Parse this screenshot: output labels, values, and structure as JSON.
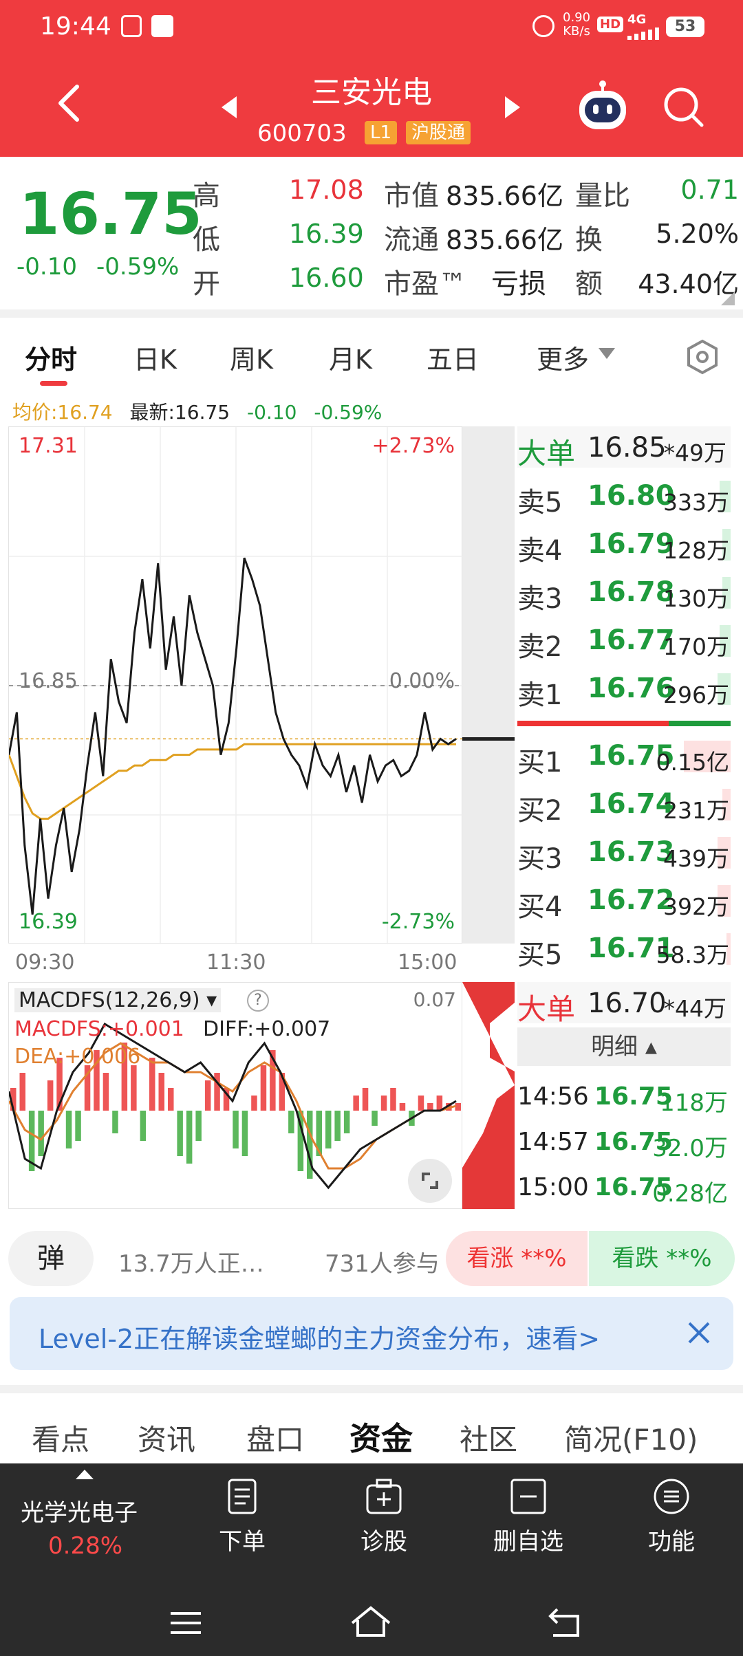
{
  "status": {
    "time": "19:44",
    "speed": "0.90",
    "speed_unit": "KB/s",
    "hd": "HD",
    "net": "4G",
    "battery": "53"
  },
  "header": {
    "title": "三安光电",
    "code": "600703",
    "tag_level": "L1",
    "tag_market": "沪股通"
  },
  "quote": {
    "price": "16.75",
    "change": "-0.10",
    "change_pct": "-0.59%",
    "high_label": "高",
    "high": "17.08",
    "low_label": "低",
    "low": "16.39",
    "open_label": "开",
    "open": "16.60",
    "mcap_label": "市值",
    "mcap": "835.66亿",
    "float_label": "流通",
    "float": "835.66亿",
    "pe_label": "市盈™",
    "pe": "亏损",
    "volratio_label": "量比",
    "volratio": "0.71",
    "turnover_label": "换",
    "turnover": "5.20%",
    "amount_label": "额",
    "amount": "43.40亿"
  },
  "tabs": [
    "分时",
    "日K",
    "周K",
    "月K",
    "五日",
    "更多"
  ],
  "chart_info": {
    "avg": "均价:16.74",
    "latest": "最新:16.75",
    "chg": "-0.10",
    "chg_pct": "-0.59%"
  },
  "chart_data": {
    "type": "line",
    "y_top": "17.31",
    "y_mid": "16.85",
    "y_bottom": "16.39",
    "pct_top": "+2.73%",
    "pct_mid": "0.00%",
    "pct_bottom": "-2.73%",
    "x_ticks": [
      "09:30",
      "11:30",
      "15:00"
    ],
    "ylim": [
      16.39,
      17.31
    ],
    "price": [
      16.72,
      16.8,
      16.55,
      16.42,
      16.6,
      16.45,
      16.55,
      16.62,
      16.5,
      16.58,
      16.7,
      16.8,
      16.68,
      16.9,
      16.82,
      16.78,
      16.95,
      17.05,
      16.92,
      17.08,
      16.88,
      16.98,
      16.85,
      17.02,
      16.95,
      16.9,
      16.85,
      16.72,
      16.78,
      16.92,
      17.09,
      17.05,
      17.0,
      16.9,
      16.8,
      16.75,
      16.72,
      16.7,
      16.66,
      16.74,
      16.7,
      16.68,
      16.72,
      16.65,
      16.7,
      16.63,
      16.72,
      16.67,
      16.7,
      16.71,
      16.68,
      16.69,
      16.72,
      16.8,
      16.73,
      16.75,
      16.74,
      16.75
    ],
    "avg": [
      16.72,
      16.68,
      16.64,
      16.61,
      16.6,
      16.6,
      16.61,
      16.62,
      16.63,
      16.64,
      16.65,
      16.66,
      16.67,
      16.68,
      16.69,
      16.69,
      16.7,
      16.7,
      16.71,
      16.71,
      16.71,
      16.72,
      16.72,
      16.72,
      16.73,
      16.73,
      16.73,
      16.73,
      16.73,
      16.73,
      16.74,
      16.74,
      16.74,
      16.74,
      16.74,
      16.74,
      16.74,
      16.74,
      16.74,
      16.74,
      16.74,
      16.74,
      16.74,
      16.74,
      16.74,
      16.74,
      16.74,
      16.74,
      16.74,
      16.74,
      16.74,
      16.74,
      16.74,
      16.74,
      16.74,
      16.74,
      16.74,
      16.74
    ]
  },
  "macd": {
    "title": "MACDFS(12,26,9)",
    "macdfs": "MACDFS:+0.001",
    "diff": "DIFF:+0.007",
    "dea": "DEA:+0.006",
    "ymax": "0.07",
    "hist": [
      0.3,
      0.5,
      -0.8,
      -0.6,
      0.4,
      0.7,
      -0.5,
      -0.4,
      0.6,
      0.8,
      0.5,
      -0.3,
      0.9,
      0.6,
      -0.4,
      0.7,
      0.5,
      0.3,
      -0.6,
      -0.7,
      -0.4,
      0.4,
      0.5,
      0.3,
      -0.5,
      -0.6,
      0.2,
      0.6,
      0.8,
      0.5,
      -0.3,
      -0.8,
      -0.9,
      -0.6,
      -0.5,
      -0.4,
      -0.3,
      0.2,
      0.3,
      -0.2,
      0.2,
      0.3,
      0.1,
      -0.2,
      0.2,
      0.1,
      0.2,
      0.1,
      0.1
    ],
    "diff_line": [
      0.2,
      -0.5,
      -0.6,
      0.0,
      0.4,
      0.6,
      0.9,
      0.8,
      0.7,
      0.6,
      0.5,
      0.4,
      0.5,
      0.3,
      0.1,
      0.5,
      0.7,
      0.4,
      0.0,
      -0.6,
      -0.8,
      -0.6,
      -0.4,
      -0.3,
      -0.2,
      -0.1,
      0.0,
      0.0,
      0.1
    ],
    "dea_line": [
      0.1,
      -0.2,
      -0.3,
      -0.1,
      0.2,
      0.4,
      0.6,
      0.7,
      0.6,
      0.5,
      0.5,
      0.4,
      0.4,
      0.3,
      0.2,
      0.4,
      0.5,
      0.4,
      0.1,
      -0.3,
      -0.6,
      -0.6,
      -0.5,
      -0.3,
      -0.2,
      -0.1,
      0.0,
      0.0,
      0.05
    ]
  },
  "orderbook": {
    "big_sell_label": "大单",
    "big_sell_price": "16.85",
    "big_sell_vol": "*49万",
    "sells": [
      {
        "label": "卖5",
        "price": "16.80",
        "vol": "333万",
        "w": 0.05
      },
      {
        "label": "卖4",
        "price": "16.79",
        "vol": "128万",
        "w": 0.04
      },
      {
        "label": "卖3",
        "price": "16.78",
        "vol": "130万",
        "w": 0.04
      },
      {
        "label": "卖2",
        "price": "16.77",
        "vol": "170万",
        "w": 0.05
      },
      {
        "label": "卖1",
        "price": "16.76",
        "vol": "296万",
        "w": 0.06
      }
    ],
    "buys": [
      {
        "label": "买1",
        "price": "16.75",
        "vol": "0.15亿",
        "w": 0.22
      },
      {
        "label": "买2",
        "price": "16.74",
        "vol": "231万",
        "w": 0.04
      },
      {
        "label": "买3",
        "price": "16.73",
        "vol": "439万",
        "w": 0.06
      },
      {
        "label": "买4",
        "price": "16.72",
        "vol": "392万",
        "w": 0.06
      },
      {
        "label": "买5",
        "price": "16.71",
        "vol": "58.3万",
        "w": 0.02
      }
    ],
    "big_buy_label": "大单",
    "big_buy_price": "16.70",
    "big_buy_vol": "*44万",
    "detail_label": "明细",
    "ticks": [
      {
        "time": "14:56",
        "price": "16.75",
        "vol": "118万"
      },
      {
        "time": "14:57",
        "price": "16.75",
        "vol": "32.0万"
      },
      {
        "time": "15:00",
        "price": "16.75",
        "vol": "0.28亿"
      }
    ]
  },
  "social": {
    "danmu": "弹",
    "readers": "13.7万人正…",
    "participants": "731人参与",
    "bull": "看涨 **%",
    "bear": "看跌 **%"
  },
  "banner": {
    "text": "Level-2正在解读金螳螂的主力资金分布，速看>"
  },
  "subtabs": [
    "看点",
    "资讯",
    "盘口",
    "资金",
    "社区",
    "简况(F10)"
  ],
  "nav": {
    "sector": "光学光电子",
    "sector_pct": "0.28%",
    "items": [
      "下单",
      "诊股",
      "删自选",
      "功能"
    ]
  }
}
